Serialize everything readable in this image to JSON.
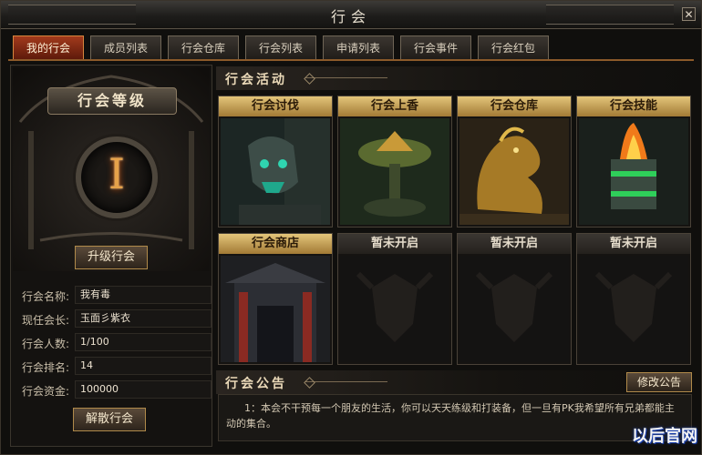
{
  "window": {
    "title": "行会",
    "close_icon": "close-icon"
  },
  "tabs": [
    {
      "label": "我的行会",
      "active": true
    },
    {
      "label": "成员列表",
      "active": false
    },
    {
      "label": "行会仓库",
      "active": false
    },
    {
      "label": "行会列表",
      "active": false
    },
    {
      "label": "申请列表",
      "active": false
    },
    {
      "label": "行会事件",
      "active": false
    },
    {
      "label": "行会红包",
      "active": false
    }
  ],
  "guild_level": {
    "banner": "行会等级",
    "level_numeral": "I",
    "upgrade_button": "升级行会"
  },
  "guild_info": [
    {
      "label": "行会名称:",
      "value": "我有毒"
    },
    {
      "label": "现任会长:",
      "value": "玉面彡紫衣"
    },
    {
      "label": "行会人数:",
      "value": "1/100"
    },
    {
      "label": "行会排名:",
      "value": "14"
    },
    {
      "label": "行会资金:",
      "value": "100000"
    }
  ],
  "disband_button": "解散行会",
  "activities": {
    "title": "行会活动",
    "items": [
      {
        "label": "行会讨伐",
        "locked": false,
        "art": "demon-statue"
      },
      {
        "label": "行会上香",
        "locked": false,
        "art": "incense-altar"
      },
      {
        "label": "行会仓库",
        "locked": false,
        "art": "golden-dragon"
      },
      {
        "label": "行会技能",
        "locked": false,
        "art": "flame-cauldron"
      },
      {
        "label": "行会商店",
        "locked": false,
        "art": "shop-gate"
      },
      {
        "label": "暂未开启",
        "locked": true,
        "art": "locked-emblem"
      },
      {
        "label": "暂未开启",
        "locked": true,
        "art": "locked-emblem"
      },
      {
        "label": "暂未开启",
        "locked": true,
        "art": "locked-emblem"
      }
    ]
  },
  "notice": {
    "title": "行会公告",
    "modify_button": "修改公告",
    "text": "1：本会不干预每一个朋友的生活，你可以天天练级和打装备，但一旦有PK我希望所有兄弟都能主动的集合。"
  },
  "watermark": {
    "text": "以后官网"
  },
  "colors": {
    "active_tab": "#a23a1c",
    "cell_title_gold": "#d4b061",
    "level_glow": "#e6a24a"
  }
}
